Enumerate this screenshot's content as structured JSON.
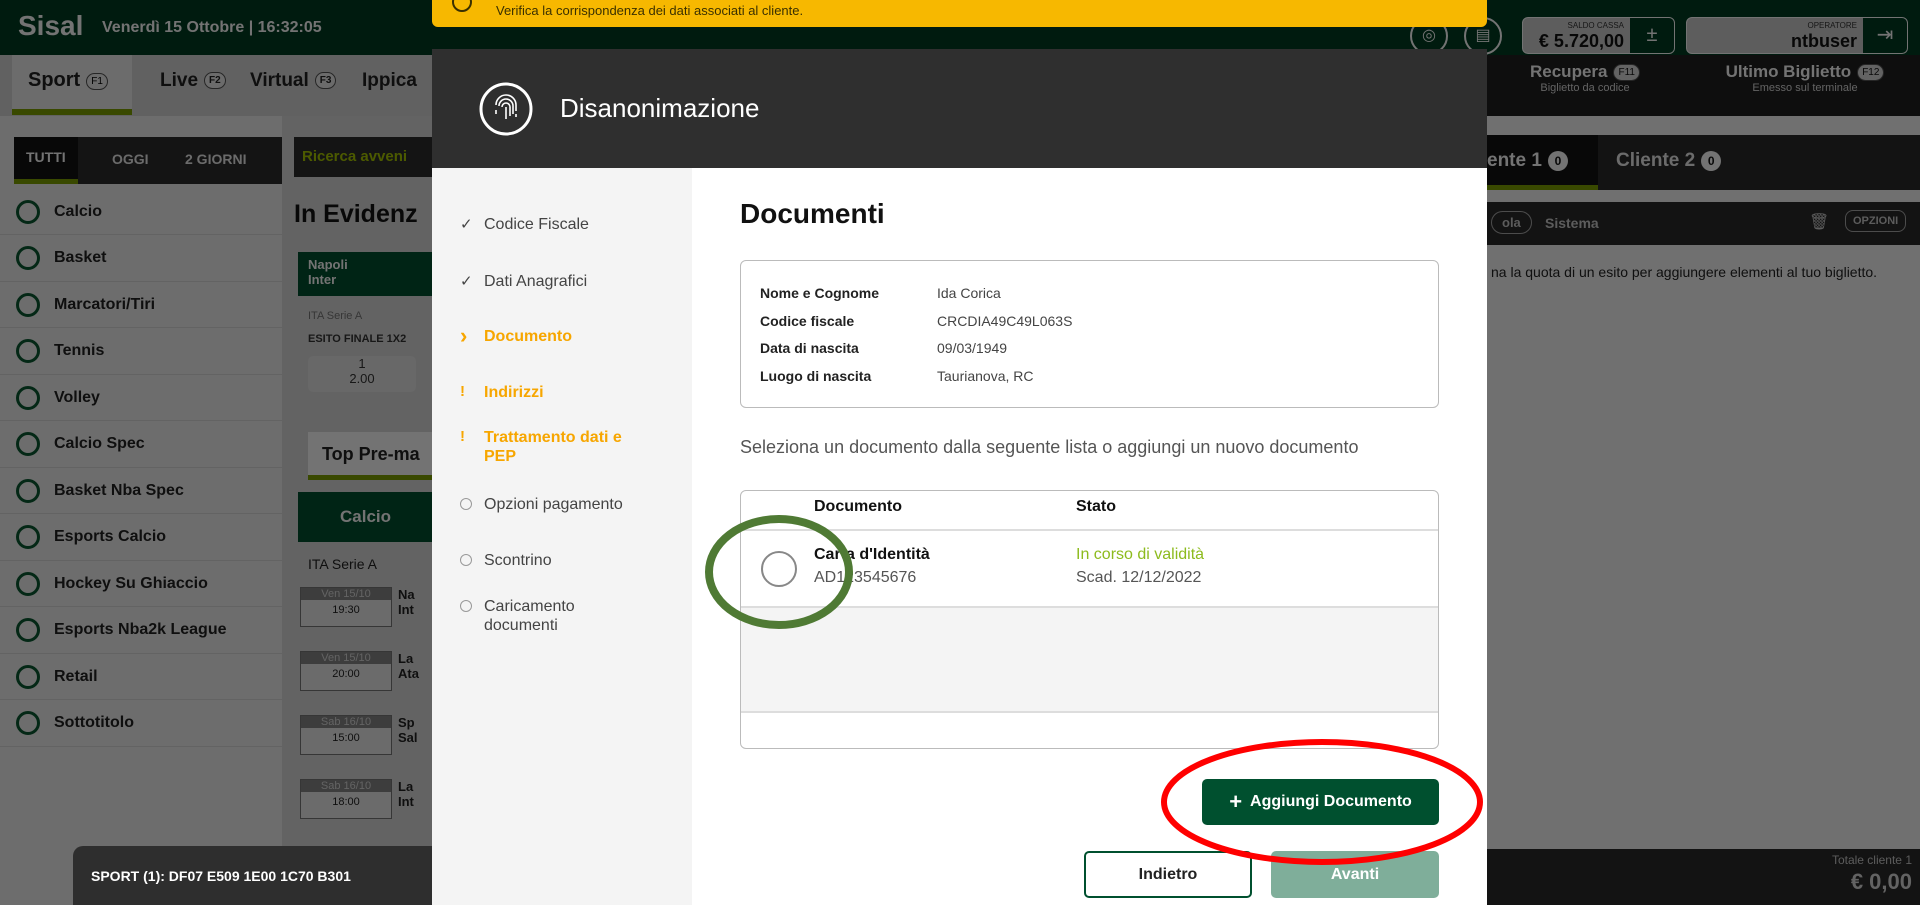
{
  "header": {
    "brand": "Sisal",
    "datetime": "Venerdì 15 Ottobre | 16:32:05",
    "saldo_label": "SALDO CASSA",
    "saldo_value": "€ 5.720,00",
    "saldo_button": "±",
    "operator_label": "OPERATORE",
    "operator_value": "ntbuser"
  },
  "nav": {
    "tabs": [
      {
        "label": "Sport",
        "key": "F1"
      },
      {
        "label": "Live",
        "key": "F2"
      },
      {
        "label": "Virtual",
        "key": "F3"
      },
      {
        "label": "Ippica"
      }
    ],
    "recupera": {
      "label": "Recupera",
      "key": "F11",
      "sub": "Biglietto da codice"
    },
    "ultimo": {
      "label": "Ultimo Biglietto",
      "key": "F12",
      "sub": "Emesso sul terminale"
    }
  },
  "filters": [
    "TUTTI",
    "OGGI",
    "2 GIORNI"
  ],
  "sports": [
    "Calcio",
    "Basket",
    "Marcatori/Tiri",
    "Tennis",
    "Volley",
    "Calcio Spec",
    "Basket Nba Spec",
    "Esports Calcio",
    "Hockey Su Ghiaccio",
    "Esports Nba2k League",
    "Retail",
    "Sottotitolo"
  ],
  "middle": {
    "search": "Ricerca avveni",
    "evidenza": "In Evidenz",
    "match": [
      "Napoli",
      "Inter"
    ],
    "league": "ITA Serie A",
    "market": "ESITO FINALE 1X2",
    "odd_label": "1",
    "odd_value": "2.00",
    "top": "Top Pre-ma",
    "calcio": "Calcio",
    "league2": "ITA Serie A",
    "events": [
      {
        "date": "Ven 15/10",
        "time": "19:30",
        "t1": "Na",
        "t2": "Int"
      },
      {
        "date": "Ven 15/10",
        "time": "20:00",
        "t1": "La",
        "t2": "Ata"
      },
      {
        "date": "Sab 16/10",
        "time": "15:00",
        "t1": "Sp",
        "t2": "Sal"
      },
      {
        "date": "Sab 16/10",
        "time": "18:00",
        "t1": "La",
        "t2": "Int"
      }
    ]
  },
  "ticket": {
    "cliente1": "ente 1",
    "cliente1_count": "0",
    "cliente2": "Cliente 2",
    "cliente2_count": "0",
    "singola": "ola",
    "sistema": "Sistema",
    "opzioni": "OPZIONI",
    "message": "na la quota di un esito per aggiungere elementi al tuo biglietto.",
    "total_label": "Totale cliente 1",
    "total_value": "€ 0,00"
  },
  "bottom_bar": {
    "code": "SPORT (1): DF07 E509 1E00 1C70 B301"
  },
  "toast": {
    "text": "Verifica la corrispondenza dei dati associati al cliente."
  },
  "modal": {
    "title": "Disanonimazione",
    "steps": [
      {
        "label": "Codice Fiscale",
        "status": "done"
      },
      {
        "label": "Dati Anagrafici",
        "status": "done"
      },
      {
        "label": "Documento",
        "status": "current"
      },
      {
        "label": "Indirizzi",
        "status": "warning"
      },
      {
        "label": "Trattamento dati e PEP",
        "status": "warning"
      },
      {
        "label": "Opzioni pagamento",
        "status": "pending"
      },
      {
        "label": "Scontrino",
        "status": "pending"
      },
      {
        "label": "Caricamento documenti",
        "status": "pending"
      }
    ],
    "section_title": "Documenti",
    "info": [
      {
        "label": "Nome e Cognome",
        "value": "Ida Corica"
      },
      {
        "label": "Codice fiscale",
        "value": "CRCDIA49C49L063S"
      },
      {
        "label": "Data di nascita",
        "value": "09/03/1949"
      },
      {
        "label": "Luogo di nascita",
        "value": "Taurianova, RC"
      }
    ],
    "instruction": "Seleziona un documento dalla seguente lista o aggiungi un nuovo documento",
    "table": {
      "headers": [
        "Documento",
        "Stato"
      ],
      "rows": [
        {
          "name": "Carta d'Identità",
          "number": "AD123545676",
          "status": "In corso di validità",
          "expiry": "Scad. 12/12/2022",
          "selected": false
        }
      ]
    },
    "add_button": "Aggiungi Documento",
    "back_button": "Indietro",
    "next_button": "Avanti"
  },
  "colors": {
    "brand_green": "#00502f",
    "accent_lime": "#7fa300",
    "warning": "#f7a600",
    "valid": "#8dbb1e",
    "annotation_green": "#4f7a34",
    "annotation_red": "#ff0000"
  }
}
